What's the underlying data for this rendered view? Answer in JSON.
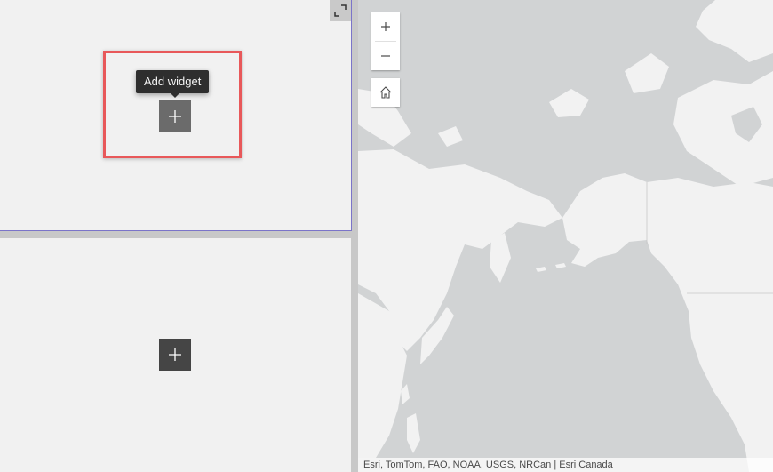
{
  "widget_panels": {
    "top": {
      "add_button_tooltip": "Add widget",
      "add_button_icon": "plus-icon",
      "expand_icon": "expand-corner-icon"
    },
    "bottom": {
      "add_button_icon": "plus-icon"
    },
    "highlight_color": "#e8585a",
    "selected_border_color": "#7b74c9"
  },
  "map": {
    "zoom_in_icon": "plus-icon",
    "zoom_out_icon": "minus-icon",
    "home_icon": "home-icon",
    "attribution": "Esri, TomTom, FAO, NOAA, USGS, NRCan | Esri Canada",
    "land_color": "#f2f2f2",
    "water_color": "#d1d3d4"
  }
}
